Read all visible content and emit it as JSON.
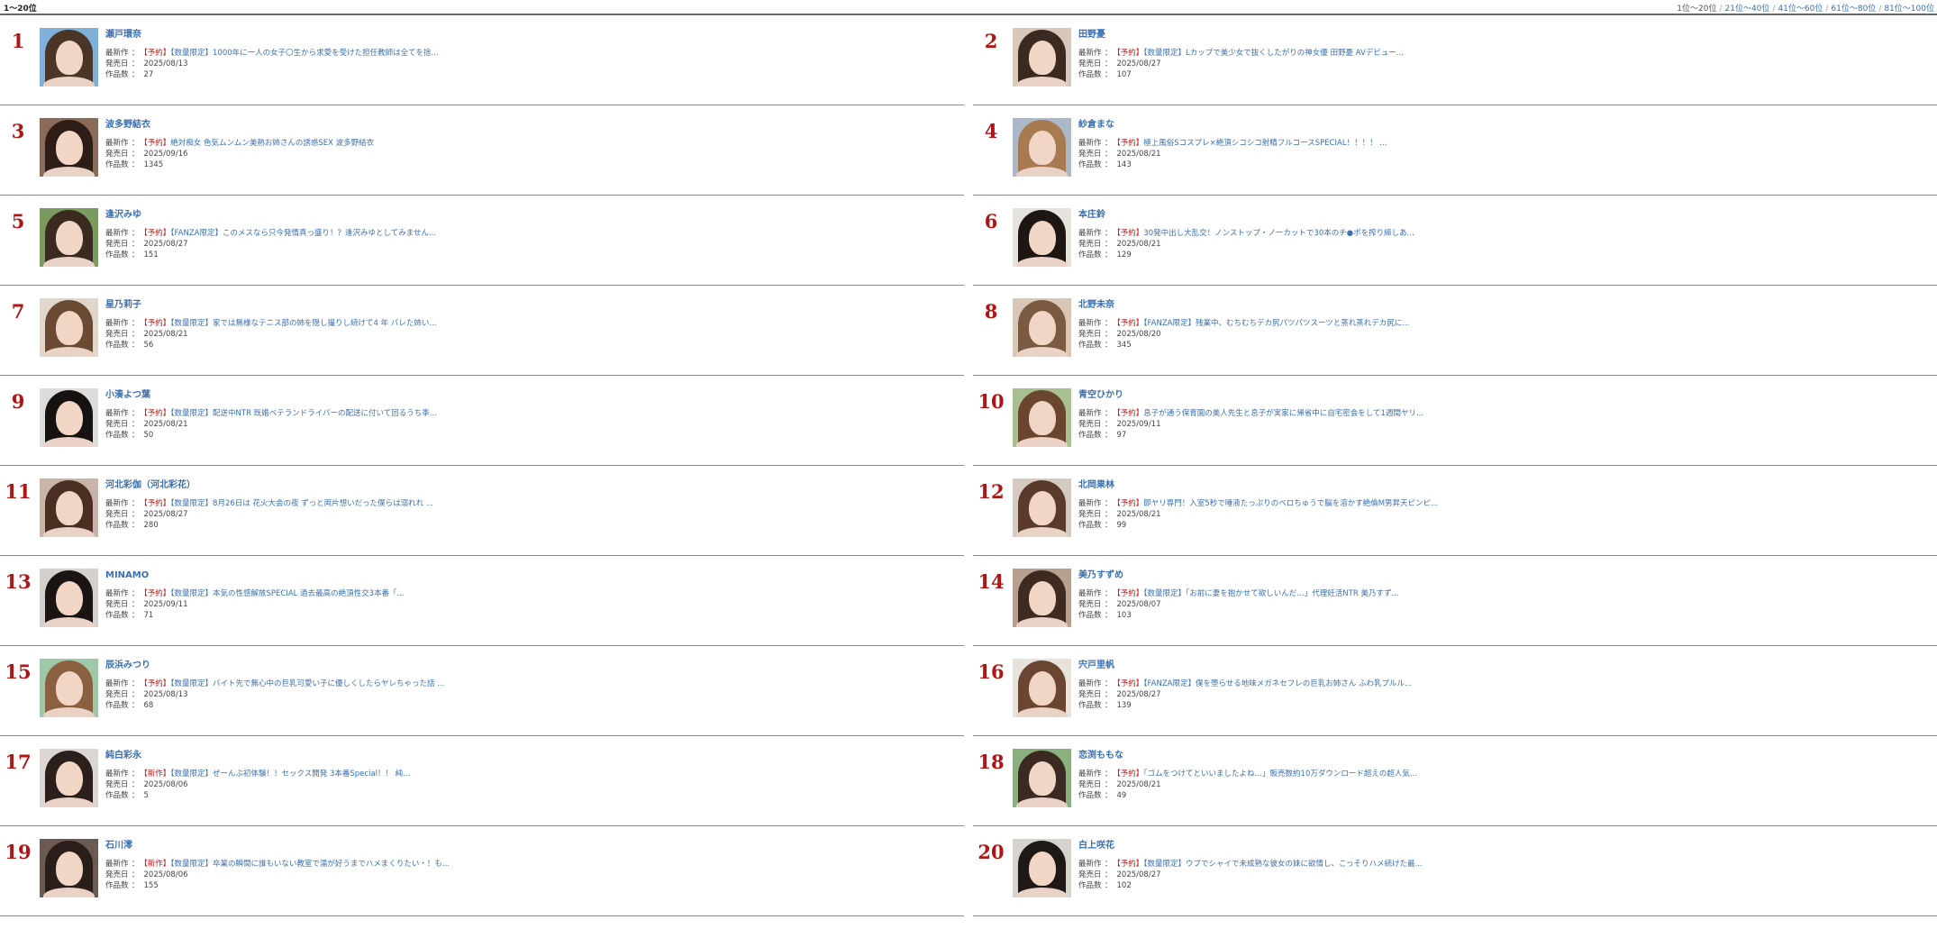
{
  "header": {
    "range_title": "1〜20位",
    "pagination": [
      {
        "label": "1位〜20位",
        "current": true
      },
      {
        "label": "21位〜40位",
        "current": false
      },
      {
        "label": "41位〜60位",
        "current": false
      },
      {
        "label": "61位〜80位",
        "current": false
      },
      {
        "label": "81位〜100位",
        "current": false
      }
    ]
  },
  "labels": {
    "latest": "最新作",
    "release": "発売日",
    "count": "作品数",
    "colon": "："
  },
  "colors": {
    "rank": "#b01414",
    "link": "#3a6fb0",
    "tag": "#c21a1a"
  },
  "entries": [
    {
      "rank": "1",
      "name": "瀬戸環奈",
      "tag": "【予約】",
      "title": "【数量限定】1000年に一人の女子〇生から求愛を受けた担任教師は全てを捨...",
      "release": "2025/08/13",
      "count": "27",
      "hair": "#4a3527",
      "bg": "#7fb0d8"
    },
    {
      "rank": "2",
      "name": "田野憂",
      "tag": "【予約】",
      "title": "【数量限定】Lカップで美少女で抜くしたがりの神女優 田野憂 AVデビュー...",
      "release": "2025/08/27",
      "count": "107",
      "hair": "#3b2a20",
      "bg": "#d8c8bc"
    },
    {
      "rank": "3",
      "name": "波多野結衣",
      "tag": "【予約】",
      "title": "絶対痴女 色気ムンムン美熟お姉さんの誘惑SEX 波多野結衣",
      "release": "2025/09/16",
      "count": "1345",
      "hair": "#2e1d16",
      "bg": "#8a6a58"
    },
    {
      "rank": "4",
      "name": "紗倉まな",
      "tag": "【予約】",
      "title": "極上風俗Sコスプレ×絶頂シコシコ射精フルコースSPECIAL！！！！ ...",
      "release": "2025/08/21",
      "count": "143",
      "hair": "#a77a52",
      "bg": "#aab8c8"
    },
    {
      "rank": "5",
      "name": "逢沢みゆ",
      "tag": "【予約】",
      "title": "【FANZA限定】このメスなら只今発情真っ盛り！？逢沢みゆとしてみません...",
      "release": "2025/08/27",
      "count": "151",
      "hair": "#3a2a1f",
      "bg": "#7a9a60"
    },
    {
      "rank": "6",
      "name": "本庄鈴",
      "tag": "【予約】",
      "title": "30発中出し大乱交！ノンストップ・ノーカットで30本のチ●ポを搾り締しあ...",
      "release": "2025/08/21",
      "count": "129",
      "hair": "#1e1612",
      "bg": "#e6e2de"
    },
    {
      "rank": "7",
      "name": "星乃莉子",
      "tag": "【予約】",
      "title": "【数量限定】家では無様なテニス部の姉を隠し撮りし続けて4 年 バレた姉い...",
      "release": "2025/08/21",
      "count": "56",
      "hair": "#6b4a33",
      "bg": "#e0d6cc"
    },
    {
      "rank": "8",
      "name": "北野未奈",
      "tag": "【予約】",
      "title": "【FANZA限定】残業中、むちむちデカ尻パツパツスーツと蒸れ蒸れデカ尻に...",
      "release": "2025/08/20",
      "count": "345",
      "hair": "#7a5a40",
      "bg": "#d8c6b6"
    },
    {
      "rank": "9",
      "name": "小湊よつ葉",
      "tag": "【予約】",
      "title": "【数量限定】配送中NTR 既婚ベテランドライバーの配送に付いて回るうち季...",
      "release": "2025/08/21",
      "count": "50",
      "hair": "#161210",
      "bg": "#dcdcdc"
    },
    {
      "rank": "10",
      "name": "青空ひかり",
      "tag": "【予約】",
      "title": "息子が通う保育園の美人先生と息子が実家に帰省中に自宅密会をして1週間ヤリ...",
      "release": "2025/09/11",
      "count": "97",
      "hair": "#6a4530",
      "bg": "#a8c090"
    },
    {
      "rank": "11",
      "name": "河北彩伽（河北彩花）",
      "tag": "【予約】",
      "title": "【数量限定】8月26日は 花火大会の夜 ずっと両片想いだった僕らは溺れれ ...",
      "release": "2025/08/27",
      "count": "280",
      "hair": "#4a2e22",
      "bg": "#c8b4a8"
    },
    {
      "rank": "12",
      "name": "北岡果林",
      "tag": "【予約】",
      "title": "即ヤリ専門！入室5秒で唾液たっぷりのベロちゅうで脳を溶かす絶倫M男昇天ピンピ...",
      "release": "2025/08/21",
      "count": "99",
      "hair": "#5a3a2a",
      "bg": "#d6cbc2"
    },
    {
      "rank": "13",
      "name": "MINAMO",
      "tag": "【予約】",
      "title": "【数量限定】本気の性感解放SPECIAL 過去最高の絶頂性交3本番「...",
      "release": "2025/09/11",
      "count": "71",
      "hair": "#1a1412",
      "bg": "#d4d0cc"
    },
    {
      "rank": "14",
      "name": "美乃すずめ",
      "tag": "【予約】",
      "title": "【数量限定】「お前に妻を抱かせて欲しいんだ…」代理妊活NTR 美乃すず...",
      "release": "2025/08/07",
      "count": "103",
      "hair": "#3e2a20",
      "bg": "#b6a090"
    },
    {
      "rank": "15",
      "name": "辰浜みつり",
      "tag": "【予約】",
      "title": "【数量限定】バイト先で無心中の巨乳可愛い子に優しくしたらヤレちゃった話 ...",
      "release": "2025/08/13",
      "count": "68",
      "hair": "#8a6040",
      "bg": "#9ec8a8"
    },
    {
      "rank": "16",
      "name": "宍戸里帆",
      "tag": "【予約】",
      "title": "【FANZA限定】僕を堕らせる地味メガネセフレの巨乳お姉さん ふわ乳プルル...",
      "release": "2025/08/27",
      "count": "139",
      "hair": "#6a4632",
      "bg": "#e8e2dc"
    },
    {
      "rank": "17",
      "name": "純白彩永",
      "tag": "【新作】",
      "title": "【数量限定】ぜーんぶ初体験！！セックス開発 3本番Special！！ 純...",
      "release": "2025/08/06",
      "count": "5",
      "hair": "#2a1f1a",
      "bg": "#dcd6d2"
    },
    {
      "rank": "18",
      "name": "恋渕ももな",
      "tag": "【予約】",
      "title": "「ゴムをつけてといいましたよね…」販売数約10万ダウンロード超えの超人気...",
      "release": "2025/08/21",
      "count": "49",
      "hair": "#3a2a22",
      "bg": "#8ab080"
    },
    {
      "rank": "19",
      "name": "石川澪",
      "tag": "【新作】",
      "title": "【数量限定】卒業の瞬間に誰もいない教室で濡が好うまでハメまくりたい・！も...",
      "release": "2025/08/06",
      "count": "155",
      "hair": "#2a1e1a",
      "bg": "#6a5a52"
    },
    {
      "rank": "20",
      "name": "白上咲花",
      "tag": "【予約】",
      "title": "【数量限定】ウブでシャイで未成熟な彼女の妹に欲情し、こっそりハメ続けた最...",
      "release": "2025/08/27",
      "count": "102",
      "hair": "#1e1816",
      "bg": "#d6d2ce"
    }
  ]
}
